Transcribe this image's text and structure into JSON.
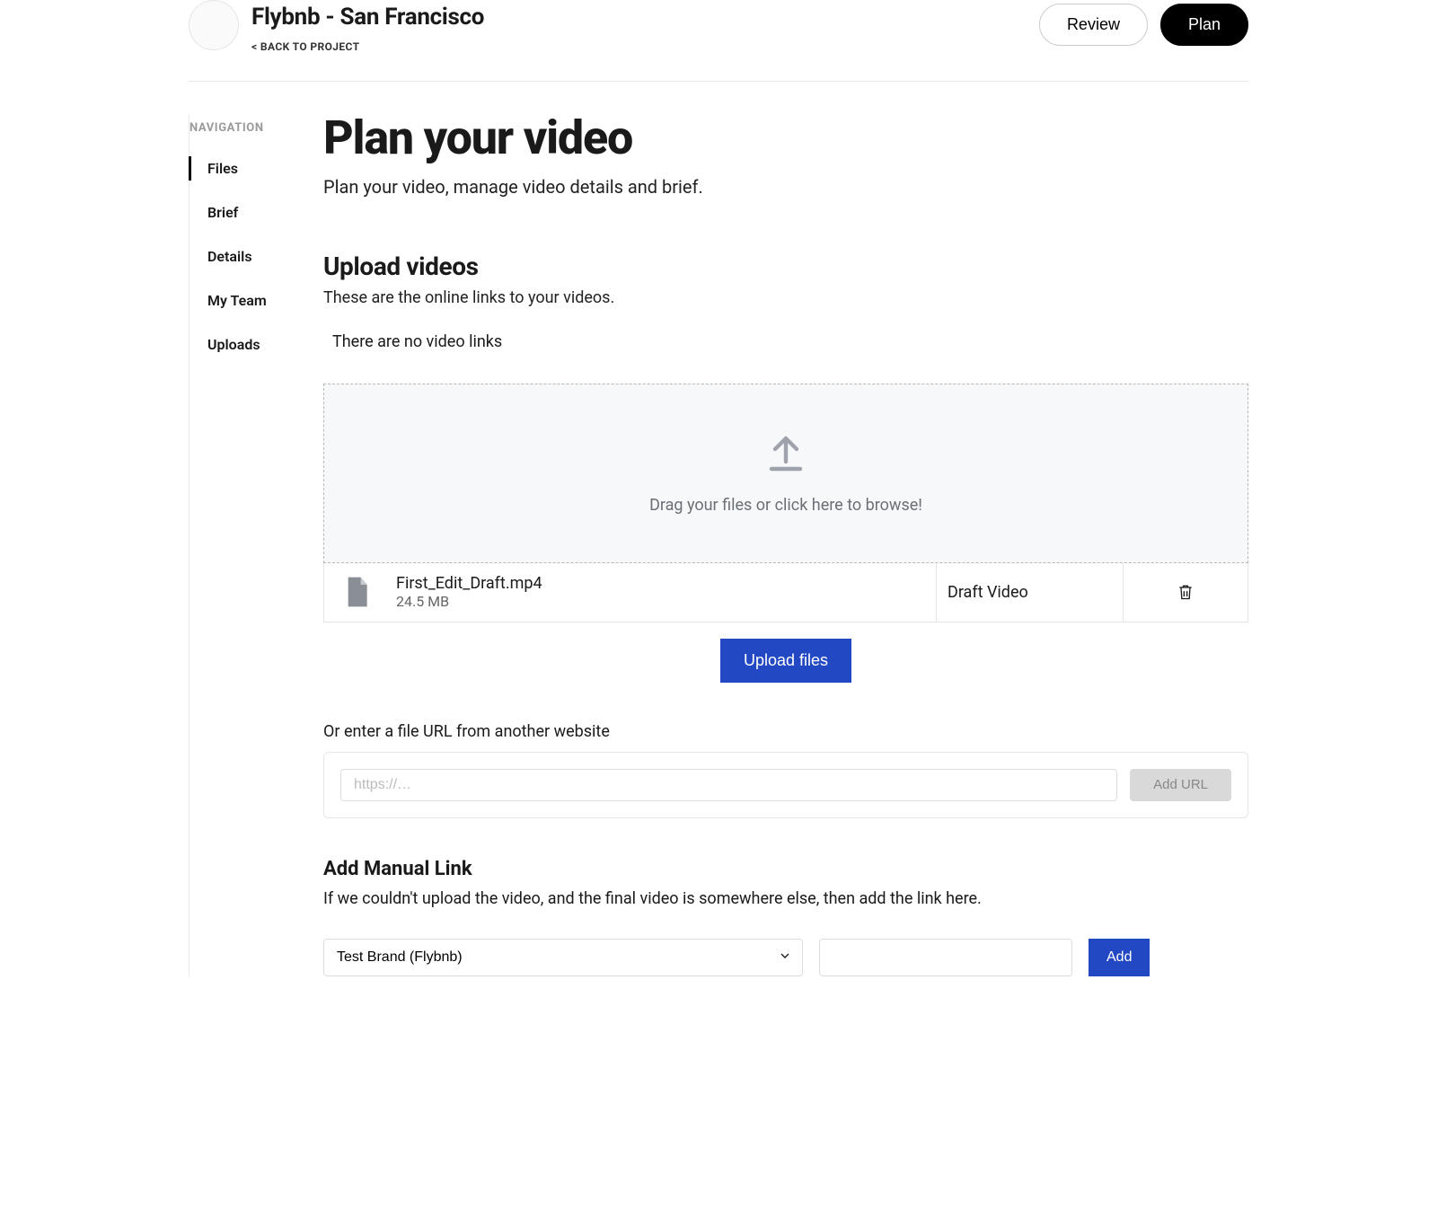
{
  "header": {
    "title": "Flybnb - San Francisco",
    "back_label": "< BACK TO PROJECT",
    "review_label": "Review",
    "plan_label": "Plan"
  },
  "sidebar": {
    "heading": "NAVIGATION",
    "items": [
      {
        "label": "Files",
        "active": true
      },
      {
        "label": "Brief",
        "active": false
      },
      {
        "label": "Details",
        "active": false
      },
      {
        "label": "My Team",
        "active": false
      },
      {
        "label": "Uploads",
        "active": false
      }
    ]
  },
  "page": {
    "title": "Plan your video",
    "subtitle": "Plan your video, manage video details and brief."
  },
  "upload_section": {
    "title": "Upload videos",
    "subtitle": "These are the online links to your videos.",
    "empty": "There are no video links",
    "dropzone_text": "Drag your files or click here to browse!",
    "upload_button": "Upload files",
    "file": {
      "name": "First_Edit_Draft.mp4",
      "size": "24.5 MB",
      "type": "Draft Video"
    }
  },
  "url_section": {
    "label": "Or enter a file URL from another website",
    "placeholder": "https://…",
    "button": "Add URL"
  },
  "manual_section": {
    "title": "Add Manual Link",
    "subtitle": "If we couldn't upload the video, and the final video is somewhere else, then add the link here.",
    "brand_value": "Test Brand (Flybnb)",
    "add_button": "Add"
  }
}
